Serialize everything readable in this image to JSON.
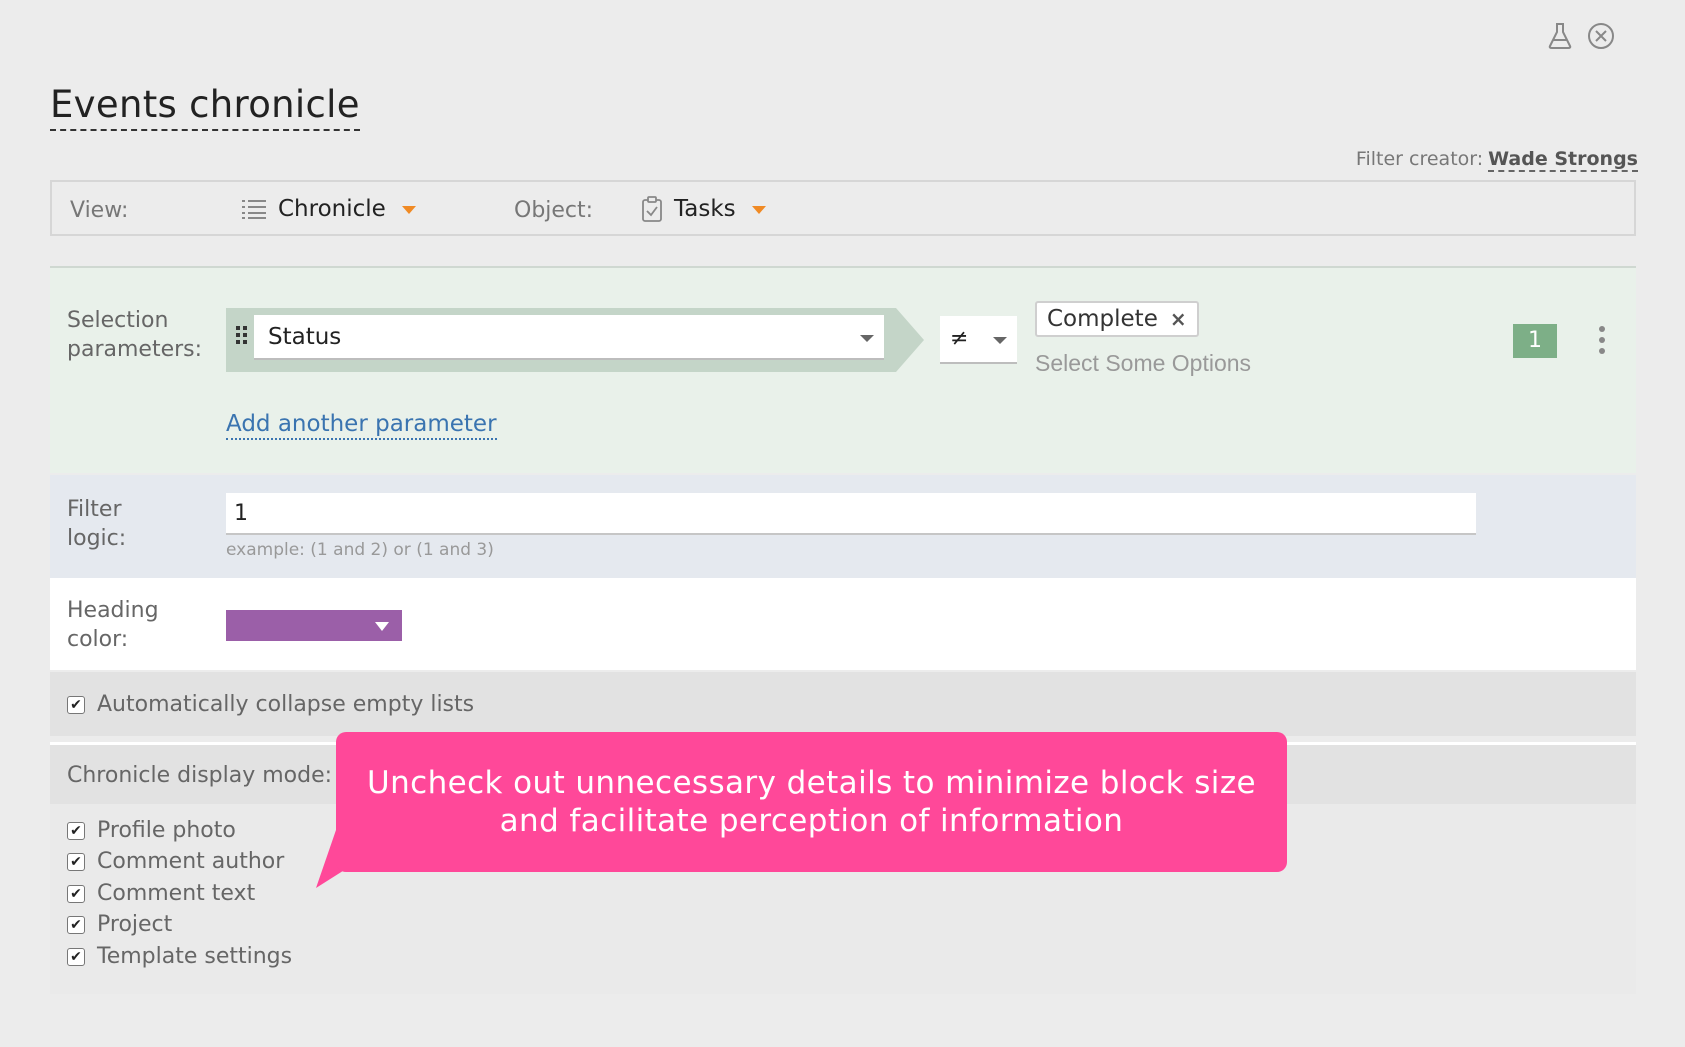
{
  "page": {
    "title": "Events chronicle"
  },
  "filter_creator": {
    "label": "Filter creator:",
    "name": "Wade Strongs"
  },
  "view_bar": {
    "view_label": "View:",
    "view_value": "Chronicle",
    "object_label": "Object:",
    "object_value": "Tasks"
  },
  "selection": {
    "label_line1": "Selection",
    "label_line2": "parameters:",
    "parameter": "Status",
    "operator": "≠",
    "chip": "Complete",
    "chip_remove": "×",
    "placeholder": "Select Some Options",
    "number": "1",
    "add_link": "Add another parameter"
  },
  "logic": {
    "label_line1": "Filter",
    "label_line2": "logic:",
    "value": "1",
    "hint": "example: (1 and 2) or (1 and 3)"
  },
  "heading": {
    "label_line1": "Heading",
    "label_line2": "color:",
    "color": "#9b5fa8"
  },
  "collapse": {
    "label": "Automatically collapse empty lists",
    "checked": true
  },
  "display_mode": {
    "label": "Chronicle display mode:",
    "options": [
      {
        "label": "Profile photo",
        "checked": true
      },
      {
        "label": "Comment author",
        "checked": true
      },
      {
        "label": "Comment text",
        "checked": true
      },
      {
        "label": "Project",
        "checked": true
      },
      {
        "label": "Template settings",
        "checked": true
      }
    ]
  },
  "callout": {
    "line1": "Uncheck out unnecessary details to minimize block size",
    "line2": "and facilitate perception of information"
  },
  "colors": {
    "accent_orange": "#f08a24",
    "badge_green": "#7daf87",
    "callout_pink": "#ff4899",
    "link_blue": "#3a74b0"
  }
}
